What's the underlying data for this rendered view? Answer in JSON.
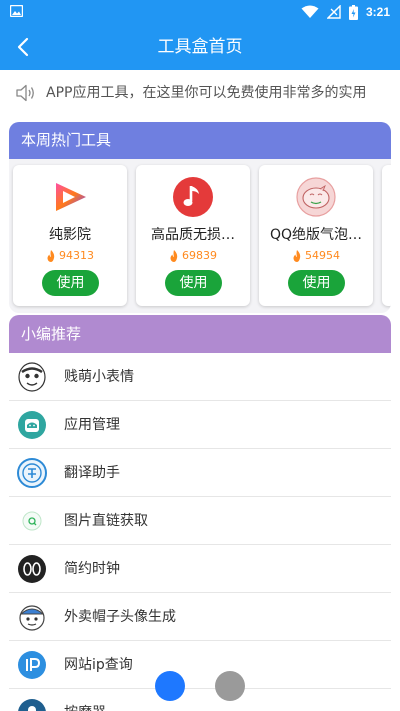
{
  "status_bar": {
    "time": "3:21",
    "icons": [
      "image-icon",
      "wifi-icon",
      "no-signal-icon",
      "battery-charging-icon"
    ]
  },
  "app_bar": {
    "title": "工具盒首页",
    "back_icon": "back-arrow-icon"
  },
  "notice": {
    "icon": "speaker-icon",
    "text": "APP应用工具，在这里你可以免费使用非常多的实用"
  },
  "hot_tools": {
    "title": "本周热门工具",
    "cards": [
      {
        "name": "纯影院",
        "heat": "94313",
        "button": "使用",
        "icon": "play-logo-icon"
      },
      {
        "name": "高品质无损…",
        "heat": "69839",
        "button": "使用",
        "icon": "music-note-icon"
      },
      {
        "name": "QQ绝版气泡…",
        "heat": "54954",
        "button": "使用",
        "icon": "bubble-pig-icon"
      }
    ]
  },
  "recommend": {
    "title": "小编推荐",
    "items": [
      {
        "label": "贱萌小表情",
        "icon": "meme-face-icon"
      },
      {
        "label": "应用管理",
        "icon": "android-app-icon"
      },
      {
        "label": "翻译助手",
        "icon": "translate-icon"
      },
      {
        "label": "图片直链获取",
        "icon": "image-link-icon"
      },
      {
        "label": "简约时钟",
        "icon": "clock-icon"
      },
      {
        "label": "外卖帽子头像生成",
        "icon": "hat-avatar-icon"
      },
      {
        "label": "网站ip查询",
        "icon": "ip-lookup-icon"
      },
      {
        "label": "按摩器",
        "icon": "massager-icon"
      }
    ]
  },
  "colors": {
    "primary": "#2196f3",
    "hot_header": "#6f7fe0",
    "recommend_header": "#b08ad0",
    "use_button": "#1aa43a",
    "heat": "#ff8a1f"
  }
}
